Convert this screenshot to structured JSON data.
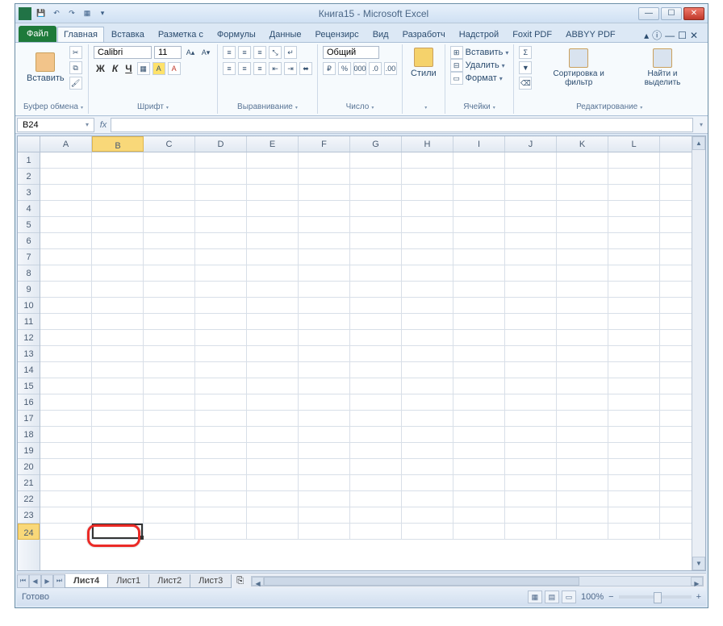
{
  "title": "Книга15  -  Microsoft Excel",
  "qat_icons": [
    "save",
    "undo",
    "redo",
    "row",
    "dropdown"
  ],
  "window_buttons": {
    "min": "—",
    "max": "☐",
    "close": "✕"
  },
  "tabs": {
    "file": "Файл",
    "list": [
      "Главная",
      "Вставка",
      "Разметка с",
      "Формулы",
      "Данные",
      "Рецензирс",
      "Вид",
      "Разработч",
      "Надстрой",
      "Foxit PDF",
      "ABBYY PDF"
    ],
    "active": 0
  },
  "ribbon_help": "ⓘ",
  "ribbon_min": "▴",
  "mdi": {
    "min": "—",
    "max": "☐",
    "close": "✕"
  },
  "groups": {
    "clipboard": {
      "label": "Буфер обмена",
      "paste": "Вставить"
    },
    "font": {
      "label": "Шрифт",
      "name": "Calibri",
      "size": "11",
      "bold": "Ж",
      "italic": "К",
      "underline": "Ч"
    },
    "align": {
      "label": "Выравнивание"
    },
    "number": {
      "label": "Число",
      "format": "Общий"
    },
    "styles": {
      "label": "",
      "btn": "Стили"
    },
    "cells": {
      "label": "Ячейки",
      "insert": "Вставить",
      "delete": "Удалить",
      "format": "Формат"
    },
    "editing": {
      "label": "Редактирование",
      "sort": "Сортировка и фильтр",
      "find": "Найти и выделить"
    }
  },
  "namebox": "B24",
  "fxlabel": "fx",
  "columns": [
    "A",
    "B",
    "C",
    "D",
    "E",
    "F",
    "G",
    "H",
    "I",
    "J",
    "K",
    "L"
  ],
  "active_col_index": 1,
  "rows": 24,
  "active_row": 24,
  "sheet_tabs": [
    "Лист4",
    "Лист1",
    "Лист2",
    "Лист3"
  ],
  "active_sheet": 0,
  "new_sheet_icon": "⎘",
  "status": "Готово",
  "zoom": "100%",
  "zoom_minus": "−",
  "zoom_plus": "+",
  "nav": {
    "first": "⏮",
    "prev": "◀",
    "next": "▶",
    "last": "⏭"
  }
}
